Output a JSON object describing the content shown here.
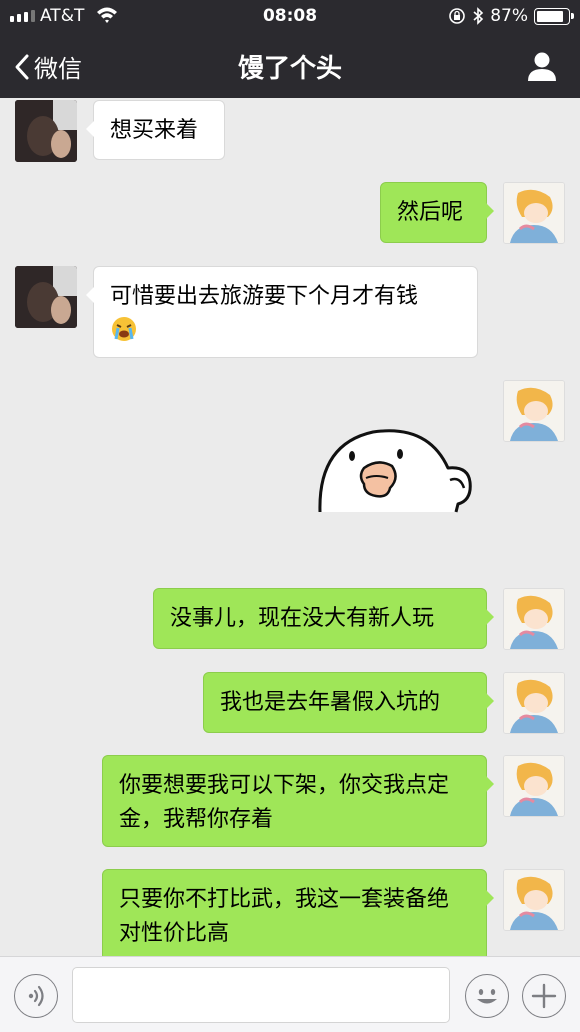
{
  "status_bar": {
    "carrier": "AT&T",
    "time": "08:08",
    "battery_percent": "87%",
    "battery_level": 0.87,
    "icons": [
      "signal-icon",
      "wifi-icon",
      "rotation-lock-icon",
      "bluetooth-icon",
      "battery-icon"
    ]
  },
  "nav": {
    "back_label": "微信",
    "title": "馒了个头",
    "profile_icon": "person-icon"
  },
  "messages": [
    {
      "side": "left",
      "text": "想买来着"
    },
    {
      "side": "right",
      "text": "然后呢"
    },
    {
      "side": "left",
      "text": "可惜要出去旅游要下个月才有钱",
      "emoji": "crying-face-emoji"
    },
    {
      "side": "right",
      "type": "sticker",
      "sticker": "round-white-bird-sticker"
    },
    {
      "side": "right",
      "text": "没事儿，现在没大有新人玩"
    },
    {
      "side": "right",
      "text": "我也是去年暑假入坑的"
    },
    {
      "side": "right",
      "text": "你要想要我可以下架，你交我点定金，我帮你存着"
    },
    {
      "side": "right",
      "text": "只要你不打比武，我这一套装备绝对性价比高"
    }
  ],
  "input_bar": {
    "voice_icon": "voice-icon",
    "input_value": "",
    "emoji_icon": "emoji-icon",
    "plus_icon": "plus-icon"
  },
  "colors": {
    "nav_background": "#2b2a2f",
    "chat_background": "#ebebeb",
    "outgoing_bubble": "#9fe658",
    "incoming_bubble": "#ffffff"
  }
}
